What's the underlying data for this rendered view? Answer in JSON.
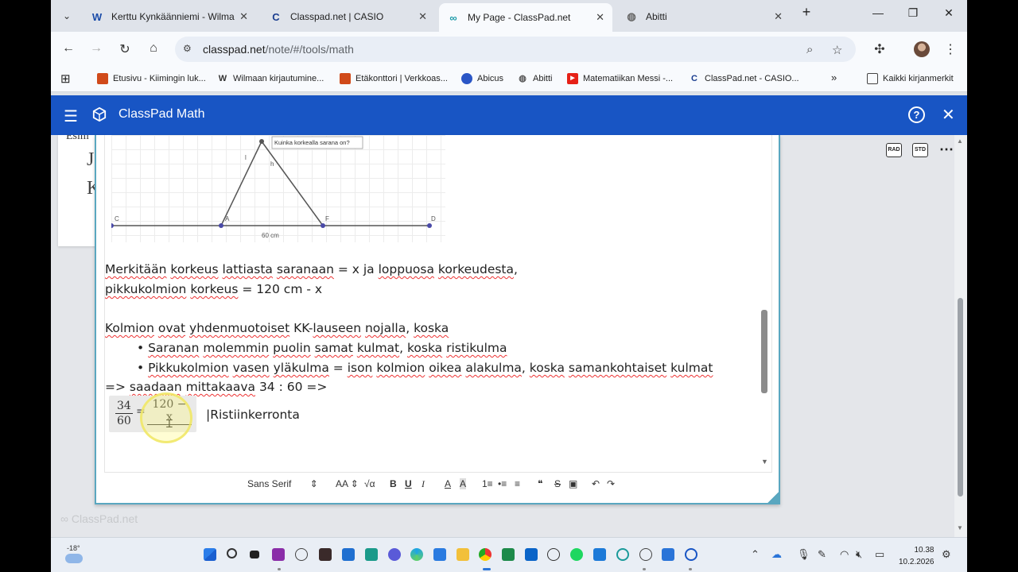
{
  "browser": {
    "tabs": [
      {
        "title": "Kerttu Kynkäänniemi - Wilma",
        "icon": "wilma-w-icon",
        "active": false
      },
      {
        "title": "Classpad.net | CASIO",
        "icon": "casio-c-icon",
        "active": false
      },
      {
        "title": "My Page - ClassPad.net",
        "icon": "classpad-link-icon",
        "active": true
      },
      {
        "title": "Abitti",
        "icon": "globe-icon",
        "active": false
      }
    ],
    "new_tab_label": "+",
    "address": {
      "host": "classpad.net",
      "path": "/note/#/tools/math"
    },
    "bookmarks": [
      {
        "label": "Etusivu - Kiimingin luk...",
        "icon": "school-icon",
        "color": "#d04a1a"
      },
      {
        "label": "Wilmaan kirjautumine...",
        "icon": "wilma-w-icon",
        "color": "#333333"
      },
      {
        "label": "Etäkonttori | Verkkoas...",
        "icon": "school-icon",
        "color": "#d04a1a"
      },
      {
        "label": "Abicus",
        "icon": "abicus-icon",
        "color": "#2a56c6"
      },
      {
        "label": "Abitti",
        "icon": "globe-icon",
        "color": "#555555"
      },
      {
        "label": "Matematiikan Messi -...",
        "icon": "youtube-icon",
        "color": "#e62117"
      },
      {
        "label": "ClassPad.net - CASIO...",
        "icon": "casio-c-icon",
        "color": "#1a3d8f"
      }
    ],
    "more_bookmarks": "»",
    "all_bookmarks": "Kaikki kirjanmerkit"
  },
  "app": {
    "title": "ClassPad Math",
    "accent": "#1855c4",
    "help_label": "?",
    "mode_buttons": [
      "RAD",
      "STD"
    ],
    "more_label": "⋯",
    "watermark": "ClassPad.net",
    "background_card": {
      "line1": "Esim",
      "line2": "Je",
      "line3": "K"
    }
  },
  "figure": {
    "question_label": "Kuinka korkealla sarana on?",
    "points": {
      "c": "C",
      "a": "A",
      "f": "F",
      "d": "D"
    },
    "side_label_l": "l",
    "side_label_h": "h",
    "base_label": "60 cm"
  },
  "note": {
    "line1_parts": [
      "Merkitään",
      " ",
      "korkeus",
      " ",
      "lattiasta",
      " ",
      "saranaan",
      " = x ja ",
      "loppuosa",
      " ",
      "korkeudesta",
      ","
    ],
    "line2_parts": [
      "pikkukolmion",
      " ",
      "korkeus",
      " = 120 cm - x"
    ],
    "line3_parts": [
      "Kolmion",
      " ",
      "ovat",
      " ",
      "yhdenmuotoiset",
      " KK-",
      "lauseen",
      " ",
      "nojalla",
      ", ",
      "koska"
    ],
    "bullet1_parts": [
      "Saranan",
      " ",
      "molemmin",
      " ",
      "puolin",
      " ",
      "samat",
      " ",
      "kulmat",
      ", ",
      "koska",
      " ",
      "ristikulma"
    ],
    "bullet2_parts": [
      "Pikkukolmion",
      " ",
      "vasen",
      " ",
      "yläkulma",
      " = ",
      "ison",
      " ",
      "kolmion",
      " ",
      "oikea",
      " ",
      "alakulma",
      ", ",
      "koska",
      " ",
      "samankohtaiset",
      " ",
      "kulmat"
    ],
    "line4_parts": [
      "=> ",
      "saadaan",
      " ",
      "mittakaava",
      " 34 : 60 =>"
    ],
    "bullet_char": "•",
    "math": {
      "lhs_num": "34",
      "lhs_den": "60",
      "eq": "=",
      "rhs_num": "120 − x",
      "rhs_den": ""
    },
    "math_note": "|Ristiinkerronta"
  },
  "format_bar": {
    "font": "Sans Serif",
    "items": [
      "AA",
      "√α",
      "B",
      "U",
      "I",
      "A",
      "A",
      "1≡",
      "•≡",
      "≡",
      "❝",
      "S",
      "▣",
      "↶",
      "↷"
    ]
  },
  "taskbar": {
    "temperature": "-18°",
    "time": "10.38",
    "date": "10.2.2026"
  }
}
